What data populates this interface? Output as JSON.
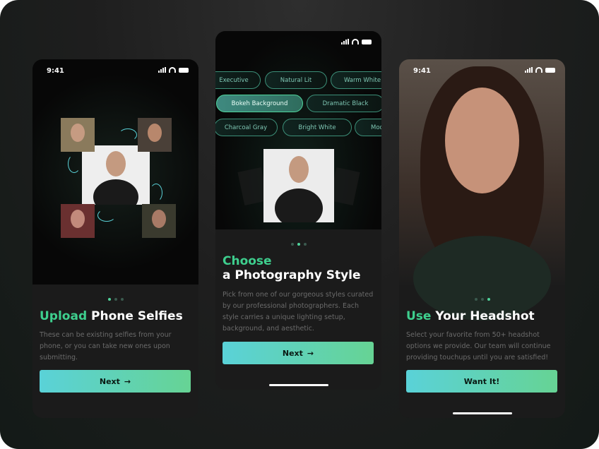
{
  "screens": [
    {
      "time": "9:41",
      "title_accent": "Upload",
      "title_rest": " Phone Selfies",
      "description": "These can be existing selfies from your phone, or you can take new ones upon submitting.",
      "button_label": "Next",
      "button_icon": "arrow-right-icon",
      "active_dot": 1
    },
    {
      "chips": [
        "Executive",
        "Natural Lit",
        "Warm White",
        "Bokeh Background",
        "Dramatic Black",
        "Charcoal Gray",
        "Bright White",
        "Mod"
      ],
      "selected_chip": "Bokeh Background",
      "title_accent": "Choose",
      "title_rest": "a Photography Style",
      "description": "Pick from one of our gorgeous styles curated by our professional photographers. Each style carries a unique lighting setup, background, and aesthetic.",
      "button_label": "Next",
      "button_icon": "arrow-right-icon",
      "active_dot": 2
    },
    {
      "time": "9:41",
      "title_accent": "Use",
      "title_rest": " Your Headshot",
      "description": "Select your favorite from 50+ headshot options we provide. Our team will continue providing touchups until you are satisfied!",
      "button_label": "Want It!",
      "active_dot": 3
    }
  ],
  "colors": {
    "accent": "#3ecf8e",
    "button_start": "#5ad2d8",
    "button_end": "#66d394"
  }
}
